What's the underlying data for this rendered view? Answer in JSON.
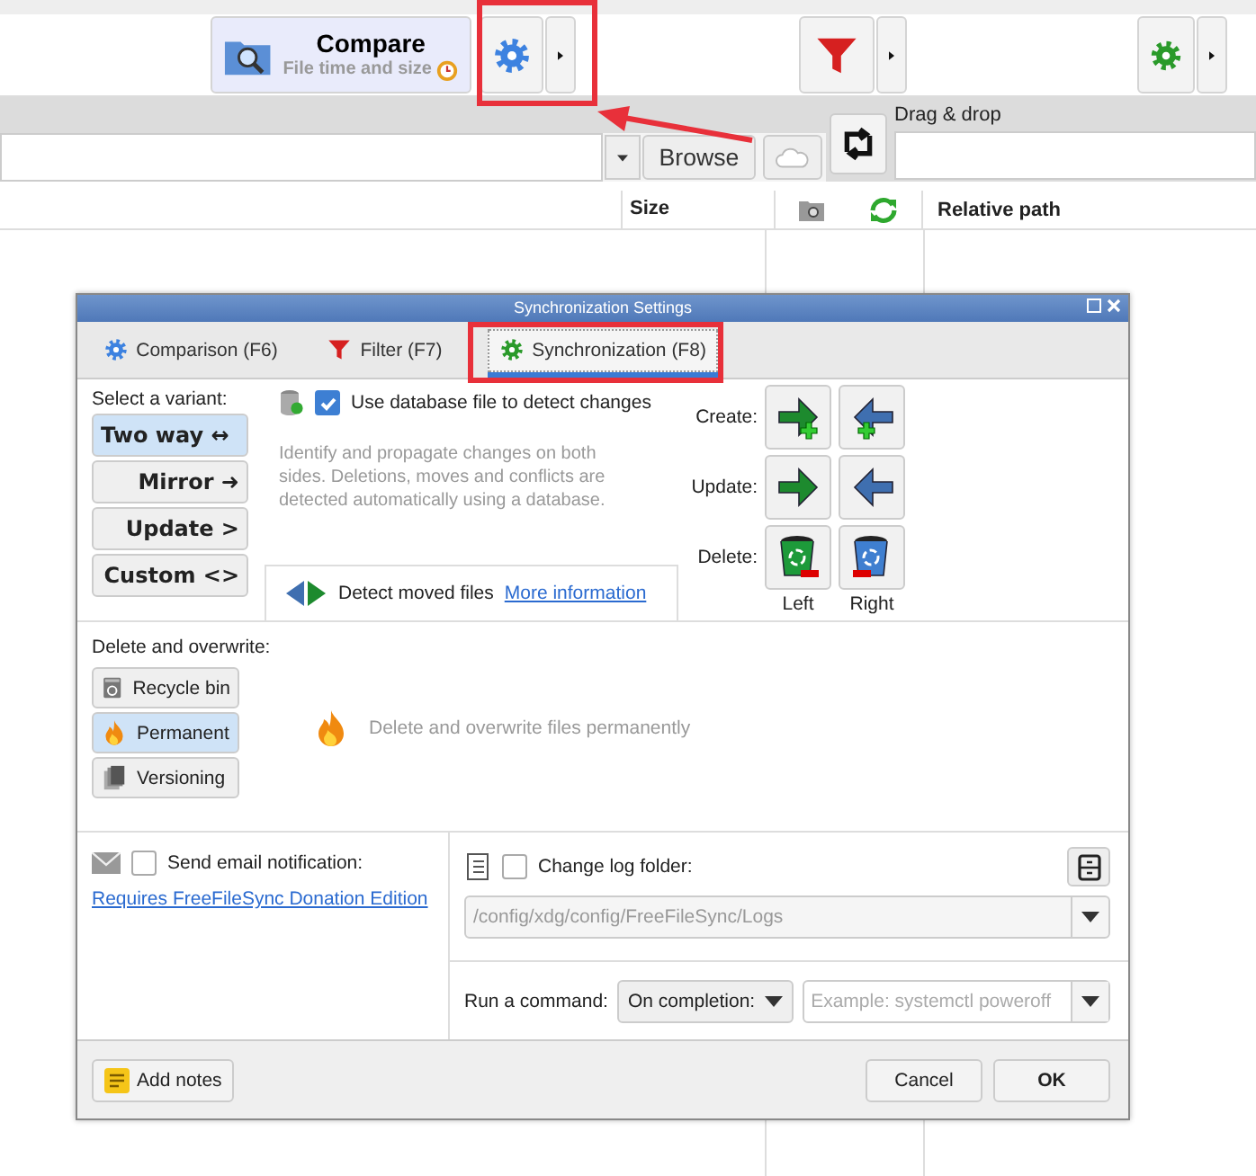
{
  "main": {
    "compare": {
      "label": "Compare",
      "sublabel": "File time and size"
    },
    "folder_bar": {
      "browse": "Browse",
      "drag_drop": "Drag & drop"
    },
    "grid": {
      "columns": [
        "Size",
        "Relative path"
      ]
    }
  },
  "dialog": {
    "title": "Synchronization Settings",
    "tabs": [
      {
        "label": "Comparison (F6)",
        "selected": false,
        "kind": "comparison"
      },
      {
        "label": "Filter (F7)",
        "selected": false,
        "kind": "filter"
      },
      {
        "label": "Synchronization (F8)",
        "selected": true,
        "kind": "sync"
      }
    ],
    "variant_label": "Select a variant:",
    "variants": [
      {
        "label": "Two way",
        "symbol": "↔",
        "selected": true
      },
      {
        "label": "Mirror",
        "symbol": "➜",
        "selected": false
      },
      {
        "label": "Update",
        "symbol": ">",
        "selected": false
      },
      {
        "label": "Custom",
        "symbol": "<>",
        "selected": false
      }
    ],
    "database": {
      "label": "Use database file to detect changes",
      "checked": true
    },
    "description": "Identify and propagate changes on both sides. Deletions, moves and conflicts are detected automatically using a database.",
    "detect_moved": {
      "label": "Detect moved files",
      "link": "More information"
    },
    "actions": [
      {
        "label": "Create:",
        "kind": "create"
      },
      {
        "label": "Update:",
        "kind": "update"
      },
      {
        "label": "Delete:",
        "kind": "delete"
      }
    ],
    "sides": [
      "Left",
      "Right"
    ],
    "delete_label": "Delete and overwrite:",
    "delete_options": [
      {
        "label": "Recycle bin",
        "selected": false,
        "kind": "recycle"
      },
      {
        "label": "Permanent",
        "selected": true,
        "kind": "permanent"
      },
      {
        "label": "Versioning",
        "selected": false,
        "kind": "versioning"
      }
    ],
    "delete_description": "Delete and overwrite files permanently",
    "email": {
      "label": "Send email notification:",
      "checked": false,
      "link": "Requires FreeFileSync Donation Edition"
    },
    "log": {
      "label": "Change log folder:",
      "checked": false,
      "path": "/config/xdg/config/FreeFileSync/Logs"
    },
    "command": {
      "label": "Run a command:",
      "trigger": "On completion:",
      "placeholder": "Example: systemctl poweroff"
    },
    "buttons": {
      "notes": "Add notes",
      "cancel": "Cancel",
      "ok": "OK"
    }
  }
}
